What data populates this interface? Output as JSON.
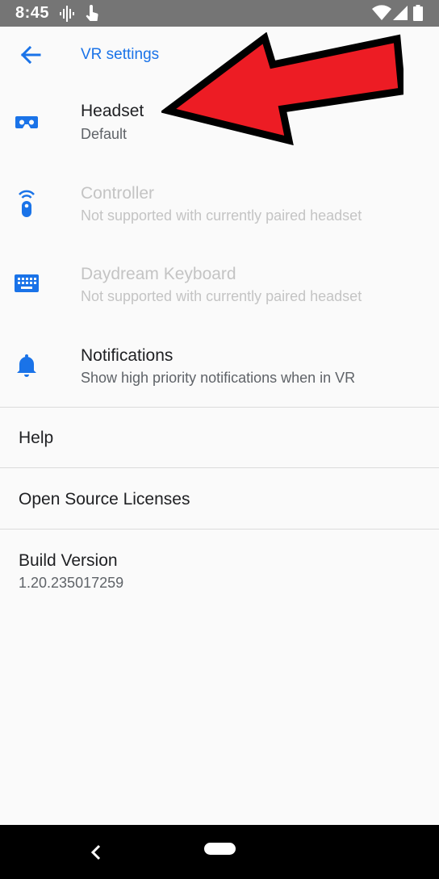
{
  "status_bar": {
    "time": "8:45",
    "icons": [
      "podcast-icon",
      "touch-icon",
      "wifi-icon",
      "signal-icon",
      "battery-icon"
    ]
  },
  "toolbar": {
    "back_icon": "arrow-back-icon",
    "title": "VR settings"
  },
  "settings": [
    {
      "icon": "headset-icon",
      "title": "Headset",
      "summary": "Default",
      "enabled": true
    },
    {
      "icon": "controller-icon",
      "title": "Controller",
      "summary": "Not supported with currently paired headset",
      "enabled": false
    },
    {
      "icon": "keyboard-icon",
      "title": "Daydream Keyboard",
      "summary": "Not supported with currently paired headset",
      "enabled": true
    },
    {
      "icon": "bell-icon",
      "title": "Notifications",
      "summary": "Show high priority notifications when in VR",
      "enabled": true
    }
  ],
  "help": {
    "title": "Help"
  },
  "licenses": {
    "title": "Open Source Licenses"
  },
  "build": {
    "title": "Build Version",
    "version": "1.20.235017259"
  },
  "nav": {
    "back_icon": "nav-back-icon",
    "home_icon": "nav-home-pill"
  },
  "colors": {
    "accent": "#1a73e8",
    "status_bar": "#757575",
    "nav_bar": "#000000",
    "arrow": "#ed1c24"
  }
}
